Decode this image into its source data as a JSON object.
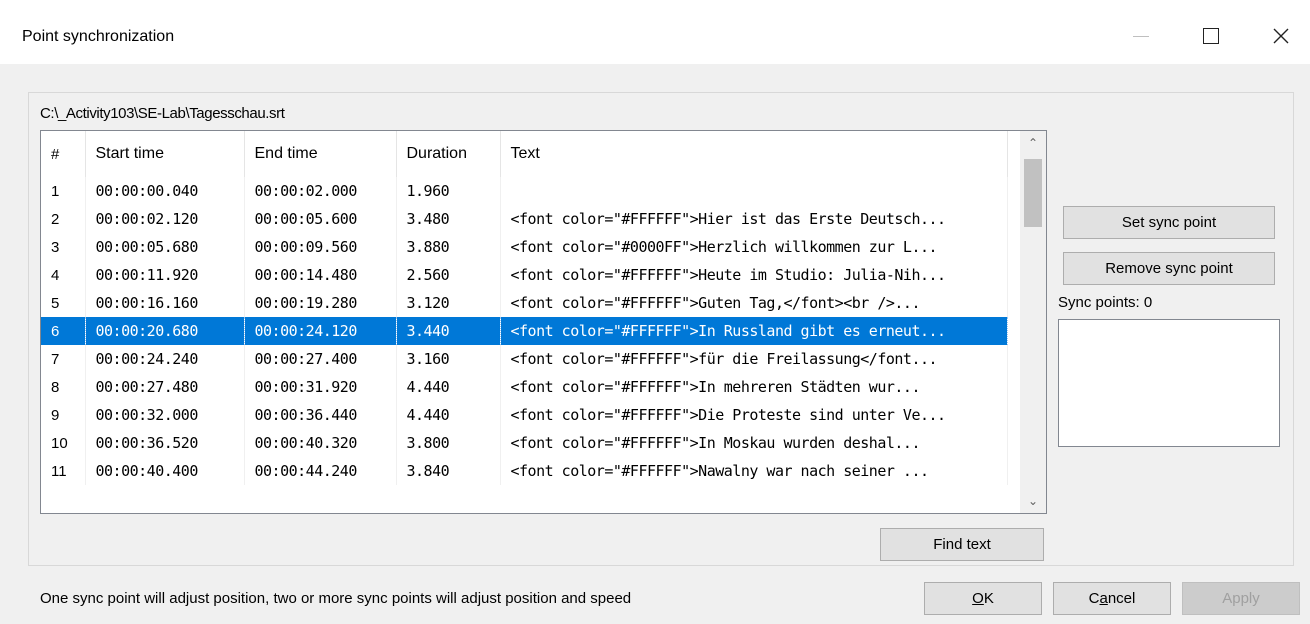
{
  "window": {
    "title": "Point synchronization",
    "controls": {
      "minimize": "minimize-icon",
      "maximize": "maximize-icon",
      "close": "close-icon"
    }
  },
  "file_path": "C:\\_Activity103\\SE-Lab\\Tagesschau.srt",
  "table": {
    "headers": {
      "num": "#",
      "start": "Start time",
      "end": "End time",
      "duration": "Duration",
      "text": "Text"
    },
    "rows": [
      {
        "num": "1",
        "start": "00:00:00.040",
        "end": "00:00:02.000",
        "duration": "1.960",
        "text": ""
      },
      {
        "num": "2",
        "start": "00:00:02.120",
        "end": "00:00:05.600",
        "duration": "3.480",
        "text": "<font color=\"#FFFFFF\">Hier ist das Erste Deutsch..."
      },
      {
        "num": "3",
        "start": "00:00:05.680",
        "end": "00:00:09.560",
        "duration": "3.880",
        "text": "<font color=\"#0000FF\">Herzlich willkommen zur L..."
      },
      {
        "num": "4",
        "start": "00:00:11.920",
        "end": "00:00:14.480",
        "duration": "2.560",
        "text": "<font color=\"#FFFFFF\">Heute im Studio: Julia-Nih..."
      },
      {
        "num": "5",
        "start": "00:00:16.160",
        "end": "00:00:19.280",
        "duration": "3.120",
        "text": "<font color=\"#FFFFFF\">Guten Tag,</font><br />..."
      },
      {
        "num": "6",
        "start": "00:00:20.680",
        "end": "00:00:24.120",
        "duration": "3.440",
        "text": "<font color=\"#FFFFFF\">In Russland gibt es erneut..."
      },
      {
        "num": "7",
        "start": "00:00:24.240",
        "end": "00:00:27.400",
        "duration": "3.160",
        "text": "<font color=\"#FFFFFF\">für die Freilassung</font..."
      },
      {
        "num": "8",
        "start": "00:00:27.480",
        "end": "00:00:31.920",
        "duration": "4.440",
        "text": "<font color=\"#FFFFFF\">In mehreren Städten wur..."
      },
      {
        "num": "9",
        "start": "00:00:32.000",
        "end": "00:00:36.440",
        "duration": "4.440",
        "text": "<font color=\"#FFFFFF\">Die Proteste sind unter Ve..."
      },
      {
        "num": "10",
        "start": "00:00:36.520",
        "end": "00:00:40.320",
        "duration": "3.800",
        "text": "<font color=\"#FFFFFF\">In Moskau wurden deshal..."
      },
      {
        "num": "11",
        "start": "00:00:40.400",
        "end": "00:00:44.240",
        "duration": "3.840",
        "text": "<font color=\"#FFFFFF\">Nawalny war nach seiner ..."
      }
    ],
    "selected_row": "6"
  },
  "buttons": {
    "set_sync_point": "Set sync point",
    "remove_sync_point": "Remove sync point",
    "find_text": "Find text",
    "ok": "OK",
    "cancel": "Cancel",
    "apply": "Apply"
  },
  "sync_points_label": "Sync points: 0",
  "hint_text": "One sync point will adjust position, two or more sync points will adjust position and speed",
  "colors": {
    "selection": "#0078d7",
    "button_face": "#e1e1e1",
    "window_bg": "#f0f0f0"
  }
}
